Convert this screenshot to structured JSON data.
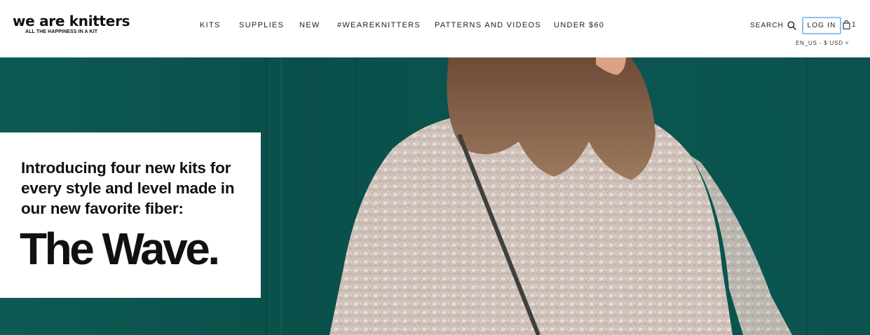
{
  "logo": {
    "title": "we are knitters",
    "tagline": "ALL THE HAPPINESS IN A KIT"
  },
  "nav": {
    "items": [
      {
        "label": "KITS"
      },
      {
        "label": "SUPPLIES"
      },
      {
        "label": "NEW"
      },
      {
        "label": "#WEAREKNITTERS"
      },
      {
        "label": "PATTERNS AND VIDEOS"
      },
      {
        "label": "UNDER $60"
      }
    ]
  },
  "header": {
    "search_label": "SEARCH",
    "search_icon": "search-icon",
    "login_label": "LOG IN",
    "cart_icon": "shopping-bag-icon",
    "cart_count": "1",
    "locale_label": "EN_US - $ USD"
  },
  "hero": {
    "intro_text": "Introducing four new kits for every style and level made in our new favorite fiber:",
    "headline": "The Wave.",
    "background_color": "#0b5550"
  }
}
